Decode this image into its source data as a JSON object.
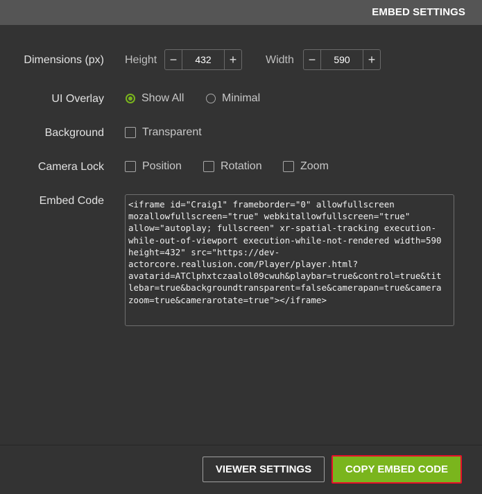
{
  "header": {
    "title": "EMBED SETTINGS"
  },
  "dimensions": {
    "label": "Dimensions (px)",
    "height": {
      "label": "Height",
      "value": "432",
      "minus": "−",
      "plus": "+"
    },
    "width": {
      "label": "Width",
      "value": "590",
      "minus": "−",
      "plus": "+"
    }
  },
  "ui_overlay": {
    "label": "UI Overlay",
    "options": [
      {
        "label": "Show All",
        "checked": true
      },
      {
        "label": "Minimal",
        "checked": false
      }
    ]
  },
  "background": {
    "label": "Background",
    "options": [
      {
        "label": "Transparent",
        "checked": false
      }
    ]
  },
  "camera_lock": {
    "label": "Camera Lock",
    "options": [
      {
        "label": "Position",
        "checked": false
      },
      {
        "label": "Rotation",
        "checked": false
      },
      {
        "label": "Zoom",
        "checked": false
      }
    ]
  },
  "embed_code": {
    "label": "Embed Code",
    "code": "<iframe id=\"Craig1\" frameborder=\"0\" allowfullscreen\nmozallowfullscreen=\"true\" webkitallowfullscreen=\"true\"\nallow=\"autoplay; fullscreen\" xr-spatial-tracking execution-\nwhile-out-of-viewport execution-while-not-rendered width=590\nheight=432\" src=\"https://dev-\nactorcore.reallusion.com/Player/player.html?\navatarid=ATClphxtczaalol09cwuh&playbar=true&control=true&tit\nlebar=true&backgroundtransparent=false&camerapan=true&camera\nzoom=true&camerarotate=true\"></iframe>"
  },
  "footer": {
    "viewer_settings": "VIEWER SETTINGS",
    "copy_embed_code": "COPY EMBED CODE"
  },
  "colors": {
    "background": "#333333",
    "header": "#555555",
    "accent_green": "#7ab51d",
    "highlight_red": "#e8102a"
  }
}
